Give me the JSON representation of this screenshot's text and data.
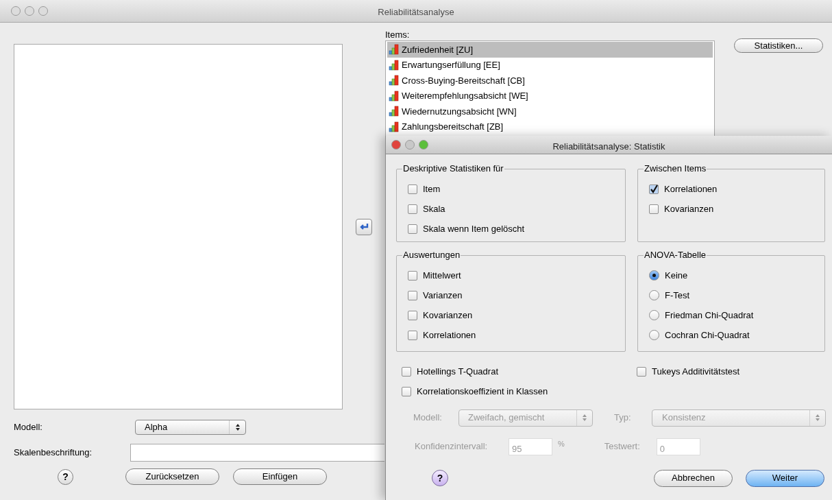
{
  "window": {
    "title": "Reliabilitätsanalyse"
  },
  "main": {
    "items_label": "Items:",
    "items": [
      {
        "label": "Zufriedenheit [ZU]",
        "selected": true
      },
      {
        "label": "Erwartungserfüllung [EE]",
        "selected": false
      },
      {
        "label": "Cross-Buying-Bereitschaft [CB]",
        "selected": false
      },
      {
        "label": "Weiterempfehlungsabsicht [WE]",
        "selected": false
      },
      {
        "label": "Wiedernutzungsabsicht [WN]",
        "selected": false
      },
      {
        "label": "Zahlungsbereitschaft [ZB]",
        "selected": false
      }
    ],
    "statistics_button": "Statistiken...",
    "model_label": "Modell:",
    "model_value": "Alpha",
    "scale_label": "Skalenbeschriftung:",
    "help_button": "?",
    "buttons": [
      "Zurücksetzen",
      "Einfügen"
    ]
  },
  "dialog": {
    "title": "Reliabilitätsanalyse: Statistik",
    "groups": [
      {
        "title": "Deskriptive Statistiken für",
        "kind": "checkbox",
        "options": [
          {
            "label": "Item",
            "checked": false
          },
          {
            "label": "Skala",
            "checked": false
          },
          {
            "label": "Skala wenn Item gelöscht",
            "checked": false
          }
        ]
      },
      {
        "title": "Zwischen Items",
        "kind": "checkbox",
        "options": [
          {
            "label": "Korrelationen",
            "checked": true
          },
          {
            "label": "Kovarianzen",
            "checked": false
          }
        ]
      },
      {
        "title": "Auswertungen",
        "kind": "checkbox",
        "options": [
          {
            "label": "Mittelwert",
            "checked": false
          },
          {
            "label": "Varianzen",
            "checked": false
          },
          {
            "label": "Kovarianzen",
            "checked": false
          },
          {
            "label": "Korrelationen",
            "checked": false
          }
        ]
      },
      {
        "title": "ANOVA-Tabelle",
        "kind": "radio",
        "options": [
          {
            "label": "Keine",
            "selected": true
          },
          {
            "label": "F-Test",
            "selected": false
          },
          {
            "label": "Friedman Chi-Quadrat",
            "selected": false
          },
          {
            "label": "Cochran Chi-Quadrat",
            "selected": false
          }
        ]
      }
    ],
    "extra_options": [
      {
        "label": "Hotellings T-Quadrat",
        "checked": false
      },
      {
        "label": "Tukeys Additivitätstest",
        "checked": false
      },
      {
        "label": "Korrelationskoeffizient in Klassen",
        "checked": false
      }
    ],
    "icc": {
      "disabled": true,
      "model_label": "Modell:",
      "model_value": "Zweifach, gemischt",
      "type_label": "Typ:",
      "type_value": "Konsistenz",
      "ci_label": "Konfidenzintervall:",
      "ci_value": "95",
      "ci_unit": "%",
      "test_label": "Testwert:",
      "test_value": "0"
    },
    "help_button": "?",
    "buttons": [
      {
        "label": "Abbrechen",
        "default": false
      },
      {
        "label": "Weiter",
        "default": true
      }
    ]
  }
}
